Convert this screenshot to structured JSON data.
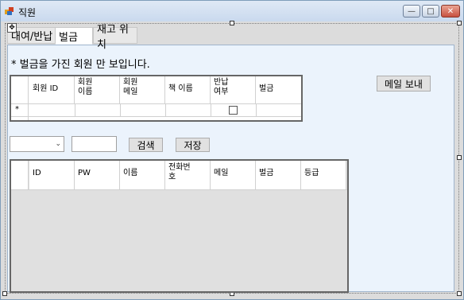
{
  "window": {
    "title": "직원",
    "controls": [
      "minimize-icon",
      "maximize-icon",
      "close-icon"
    ]
  },
  "tabs": [
    {
      "label": "대여/반납",
      "active": false
    },
    {
      "label": "벌금",
      "active": true
    },
    {
      "label": "재고 위치",
      "active": false
    }
  ],
  "fine_tab": {
    "notice": "* 벌금을 가진 회원 만 보입니다.",
    "mail_button": "메일 보내",
    "fine_grid": {
      "columns": [
        "회원 ID",
        "회원\n이름",
        "회원\n메일",
        "책 이름",
        "반납\n여부",
        "벌금"
      ],
      "new_row_marker": "*"
    },
    "search": {
      "combo_value": "",
      "text_value": "",
      "search_button": "검색",
      "save_button": "저장"
    },
    "member_grid": {
      "columns": [
        "ID",
        "PW",
        "이름",
        "전화번\n호",
        "메일",
        "벌금",
        "등급"
      ]
    }
  },
  "colors": {
    "page_background": "#ebf3fc",
    "grid_empty_area": "#e0e0e0",
    "button_face": "#e1e1e1"
  }
}
